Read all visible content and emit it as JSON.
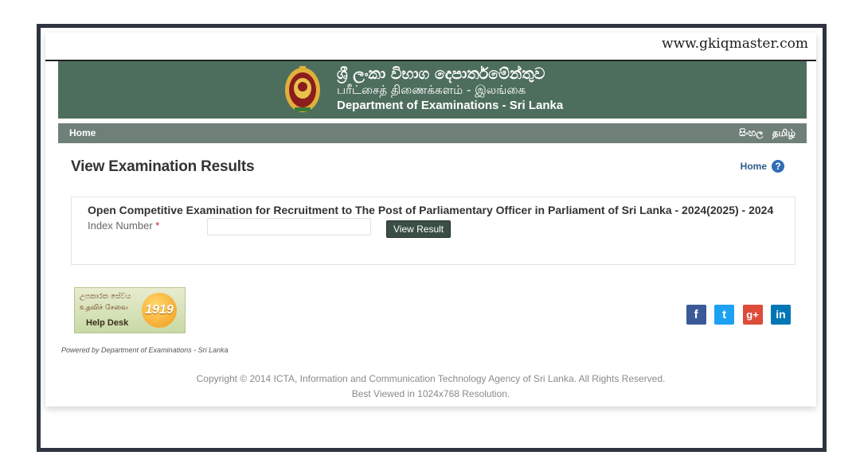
{
  "watermark": "www.gkiqmaster.com",
  "header": {
    "title_si": "ශ්‍රී ලංකා විභාග දෙපාර්තමේන්තුව",
    "title_ta": "பரீட்சைத் திணைக்களம் - இலங்கை",
    "title_en": "Department of Examinations - Sri Lanka",
    "banner_color": "#4e6e5d"
  },
  "nav": {
    "home_label": "Home",
    "lang_si": "සිංහල",
    "lang_ta": "தமிழ்"
  },
  "main": {
    "page_title": "View Examination Results",
    "home_link": "Home",
    "help_icon": "?",
    "exam_title": "Open Competitive Examination for Recruitment to The Post of Parliamentary Officer in Parliament of Sri Lanka - 2024(2025) - 2024",
    "index_label": "Index Number",
    "required_mark": "*",
    "index_value": "",
    "view_button": "View Result"
  },
  "footer": {
    "helpdesk_line1": "උපකාරක සේවය",
    "helpdesk_line2": "உதவிச் சேவை",
    "helpdesk_label": "Help Desk",
    "helpdesk_number": "1919",
    "powered_by": "Powered by Department of Examinations - Sri Lanka",
    "social": [
      {
        "icon": "facebook-icon",
        "glyph": "f",
        "color": "#3b5998"
      },
      {
        "icon": "twitter-icon",
        "glyph": "t",
        "color": "#1da1f2"
      },
      {
        "icon": "google-plus-icon",
        "glyph": "g+",
        "color": "#dd4b39"
      },
      {
        "icon": "linkedin-icon",
        "glyph": "in",
        "color": "#0077b5"
      }
    ],
    "copyright": "Copyright © 2014 ICTA, Information and Communication Technology Agency of Sri Lanka. All Rights Reserved.",
    "best_viewed": "Best Viewed in 1024x768 Resolution."
  }
}
